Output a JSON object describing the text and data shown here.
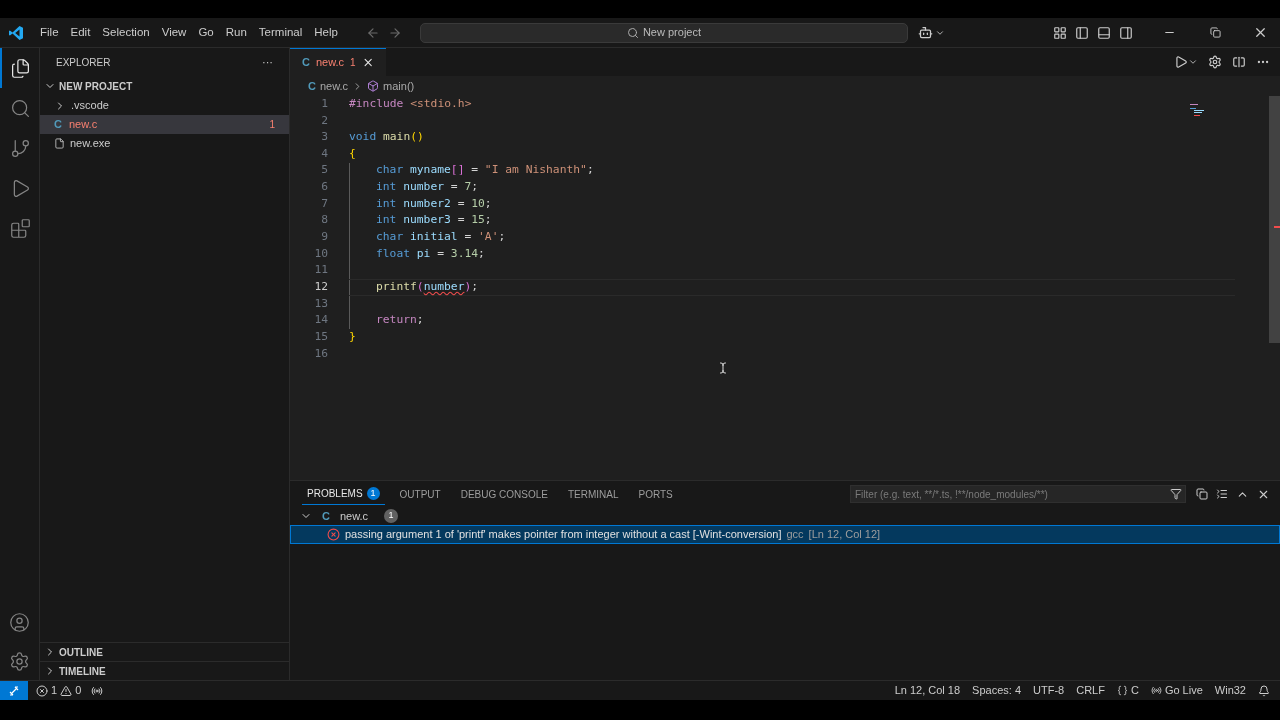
{
  "title_bar": {
    "menus": [
      "File",
      "Edit",
      "Selection",
      "View",
      "Go",
      "Run",
      "Terminal",
      "Help"
    ],
    "command_center": "New project"
  },
  "activity_bar": {
    "items": [
      {
        "kind": "files",
        "selected": true
      },
      {
        "kind": "search",
        "selected": false
      },
      {
        "kind": "source-control",
        "selected": false
      },
      {
        "kind": "run-debug",
        "selected": false
      },
      {
        "kind": "extensions",
        "selected": false
      }
    ]
  },
  "sidebar": {
    "title": "EXPLORER",
    "more": "···",
    "project": {
      "label": "NEW PROJECT",
      "expanded": true,
      "items": [
        {
          "kind": "folder",
          "label": ".vscode",
          "expanded": false,
          "selected": false,
          "error": false
        },
        {
          "kind": "c",
          "icon": "C",
          "label": "new.c",
          "selected": true,
          "error": true,
          "badge": "1"
        },
        {
          "kind": "exe",
          "label": "new.exe",
          "selected": false,
          "error": false
        }
      ]
    },
    "sections": [
      {
        "label": "OUTLINE",
        "expanded": false
      },
      {
        "label": "TIMELINE",
        "expanded": false
      }
    ]
  },
  "editor": {
    "tabs": [
      {
        "icon": "C",
        "label": "new.c",
        "badge": "1",
        "error": true,
        "selected": true
      }
    ],
    "breadcrumb": {
      "icon": "C",
      "file": "new.c",
      "symbol": "main()"
    },
    "lines": [
      {
        "number": "1",
        "indented": false,
        "current": false,
        "tokens": [
          {
            "kind": "preproc",
            "text": "#include "
          },
          {
            "kind": "string",
            "text": "<stdio.h>"
          }
        ]
      },
      {
        "number": "2",
        "indented": false,
        "current": false
      },
      {
        "number": "3",
        "indented": false,
        "current": false,
        "tokens": [
          {
            "kind": "keyword",
            "text": "void "
          },
          {
            "kind": "function",
            "text": "main"
          },
          {
            "kind": "bracket",
            "text": "()"
          }
        ]
      },
      {
        "number": "4",
        "indented": false,
        "current": false,
        "tokens": [
          {
            "kind": "bracket",
            "text": "{"
          }
        ]
      },
      {
        "number": "5",
        "indented": true,
        "current": false,
        "tokens": [
          {
            "kind": "keyword",
            "text": "char "
          },
          {
            "kind": "variable",
            "text": "myname"
          },
          {
            "kind": "bracket2",
            "text": "[]"
          },
          {
            "kind": "plain",
            "text": " = "
          },
          {
            "kind": "string",
            "text": "\"I am Nishanth\""
          },
          {
            "kind": "plain",
            "text": ";"
          }
        ]
      },
      {
        "number": "6",
        "indented": true,
        "current": false,
        "tokens": [
          {
            "kind": "keyword",
            "text": "int "
          },
          {
            "kind": "variable",
            "text": "number"
          },
          {
            "kind": "plain",
            "text": " = "
          },
          {
            "kind": "number",
            "text": "7"
          },
          {
            "kind": "plain",
            "text": ";"
          }
        ]
      },
      {
        "number": "7",
        "indented": true,
        "current": false,
        "tokens": [
          {
            "kind": "keyword",
            "text": "int "
          },
          {
            "kind": "variable",
            "text": "number2"
          },
          {
            "kind": "plain",
            "text": " = "
          },
          {
            "kind": "number",
            "text": "10"
          },
          {
            "kind": "plain",
            "text": ";"
          }
        ]
      },
      {
        "number": "8",
        "indented": true,
        "current": false,
        "tokens": [
          {
            "kind": "keyword",
            "text": "int "
          },
          {
            "kind": "variable",
            "text": "number3"
          },
          {
            "kind": "plain",
            "text": " = "
          },
          {
            "kind": "number",
            "text": "15"
          },
          {
            "kind": "plain",
            "text": ";"
          }
        ]
      },
      {
        "number": "9",
        "indented": true,
        "current": false,
        "tokens": [
          {
            "kind": "keyword",
            "text": "char "
          },
          {
            "kind": "variable",
            "text": "initial"
          },
          {
            "kind": "plain",
            "text": " = "
          },
          {
            "kind": "string",
            "text": "'A'"
          },
          {
            "kind": "plain",
            "text": ";"
          }
        ]
      },
      {
        "number": "10",
        "indented": true,
        "current": false,
        "tokens": [
          {
            "kind": "keyword",
            "text": "float "
          },
          {
            "kind": "variable",
            "text": "pi"
          },
          {
            "kind": "plain",
            "text": " = "
          },
          {
            "kind": "number",
            "text": "3.14"
          },
          {
            "kind": "plain",
            "text": ";"
          }
        ]
      },
      {
        "number": "11",
        "indented": true,
        "current": false
      },
      {
        "number": "12",
        "indented": true,
        "current": true,
        "tokens": [
          {
            "kind": "function",
            "text": "printf"
          },
          {
            "kind": "bracket2",
            "text": "("
          },
          {
            "kind": "variable",
            "text": "number",
            "error": true
          },
          {
            "kind": "bracket2",
            "text": ")"
          },
          {
            "kind": "plain",
            "text": ";"
          }
        ]
      },
      {
        "number": "13",
        "indented": true,
        "current": false
      },
      {
        "number": "14",
        "indented": true,
        "current": false,
        "tokens": [
          {
            "kind": "control",
            "text": "return"
          },
          {
            "kind": "plain",
            "text": ";"
          }
        ]
      },
      {
        "number": "15",
        "indented": false,
        "current": false,
        "tokens": [
          {
            "kind": "bracket",
            "text": "}"
          }
        ]
      },
      {
        "number": "16",
        "indented": false,
        "current": false
      }
    ]
  },
  "panel": {
    "tabs": [
      {
        "label": "PROBLEMS",
        "selected": true,
        "badge": "1"
      },
      {
        "label": "OUTPUT",
        "selected": false
      },
      {
        "label": "DEBUG CONSOLE",
        "selected": false
      },
      {
        "label": "TERMINAL",
        "selected": false
      },
      {
        "label": "PORTS",
        "selected": false
      }
    ],
    "filter": {
      "placeholder": "Filter (e.g. text, **/*.ts, !**/node_modules/**)"
    },
    "problems": [
      {
        "icon": "C",
        "file": "new.c",
        "count": "1",
        "expanded": true,
        "items": [
          {
            "kind": "error",
            "message": "passing argument 1 of 'printf' makes pointer from integer without a cast [-Wint-conversion]",
            "source": "gcc",
            "location": "[Ln 12, Col 12]",
            "selected": true
          }
        ]
      }
    ]
  },
  "status_bar": {
    "errors": "1",
    "warnings": "0",
    "right": [
      {
        "kind": "text",
        "label": "Ln 12, Col 18"
      },
      {
        "kind": "text",
        "label": "Spaces: 4"
      },
      {
        "kind": "text",
        "label": "UTF-8"
      },
      {
        "kind": "text",
        "label": "CRLF"
      },
      {
        "kind": "language",
        "label": "C"
      },
      {
        "kind": "live",
        "label": "Go Live"
      },
      {
        "kind": "text",
        "label": "Win32"
      },
      {
        "kind": "bell"
      }
    ]
  }
}
